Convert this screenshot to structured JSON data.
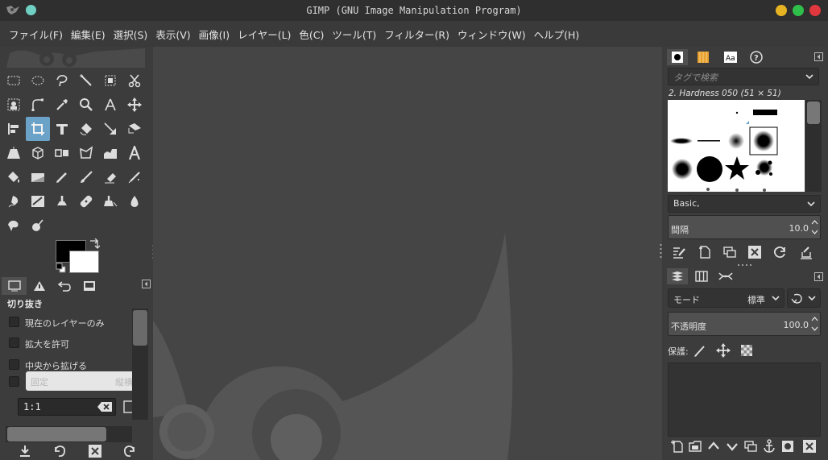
{
  "window": {
    "title": "GIMP (GNU Image Manipulation Program)",
    "colors": {
      "minimize": "#e6b422",
      "maximize": "#2fbf4a",
      "close": "#e0383e",
      "app_badge": "#6fcfc3"
    }
  },
  "menu": [
    "ファイル(F)",
    "編集(E)",
    "選択(S)",
    "表示(V)",
    "画像(I)",
    "レイヤー(L)",
    "色(C)",
    "ツール(T)",
    "フィルター(R)",
    "ウィンドウ(W)",
    "ヘルプ(H)"
  ],
  "toolbox": {
    "active_tool": "crop-tool",
    "tools": [
      "rect-select",
      "ellipse-select",
      "free-select",
      "fuzzy-select",
      "by-color-select",
      "scissors-select",
      "foreground-select",
      "paths",
      "color-picker",
      "zoom",
      "measure",
      "move",
      "align",
      "crop",
      "unified-transform",
      "rotate",
      "scale",
      "shear",
      "perspective",
      "3d-transform",
      "flip",
      "cage",
      "warp-transform",
      "text",
      "bucket-fill",
      "blend",
      "pencil",
      "paintbrush",
      "eraser",
      "airbrush",
      "ink",
      "mypaint-brush",
      "clone",
      "heal",
      "perspective-clone",
      "blur",
      "smudge",
      "dodge-burn"
    ],
    "fg_color": "#000000",
    "bg_color": "#ffffff"
  },
  "tool_options": {
    "title": "切り抜き",
    "options": [
      {
        "label": "現在のレイヤーのみ",
        "checked": false
      },
      {
        "label": "拡大を許可",
        "checked": false
      },
      {
        "label": "中央から拡げる",
        "checked": false
      }
    ],
    "fixed_label": "固定",
    "fixed_value": "縦横",
    "ratio": "1:1"
  },
  "brushes": {
    "tag_placeholder": "タグで検索",
    "selected": "2. Hardness 050 (51 × 51)",
    "preset": "Basic,",
    "spacing_label": "間隔",
    "spacing_value": "10.0"
  },
  "layers": {
    "mode_label": "モード",
    "mode_value": "標準",
    "opacity_label": "不透明度",
    "opacity_value": "100.0",
    "lock_label": "保護:"
  }
}
